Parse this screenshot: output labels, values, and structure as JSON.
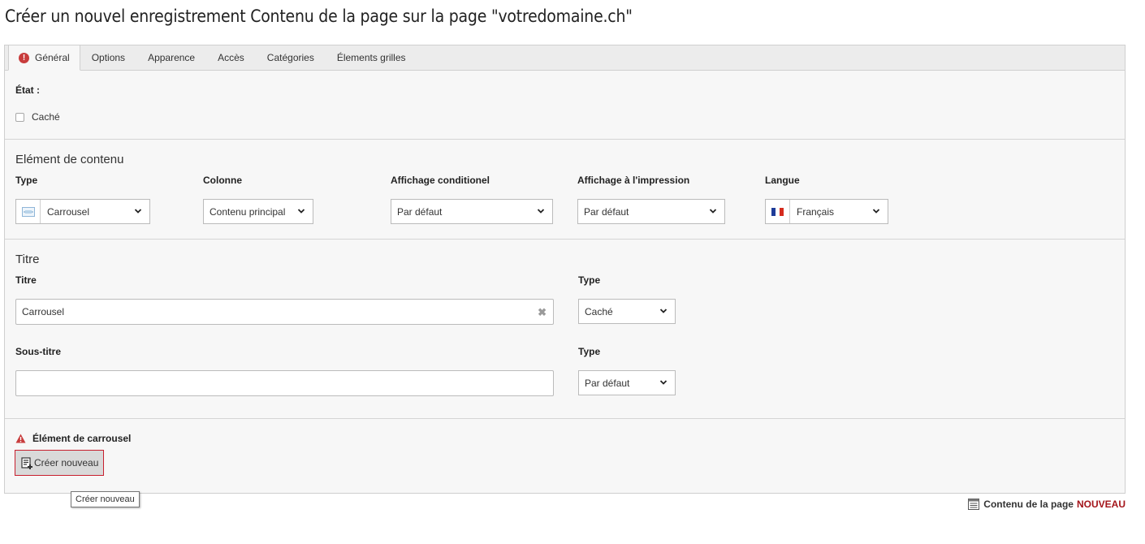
{
  "page_title": "Créer un nouvel enregistrement Contenu de la page sur la page \"votredomaine.ch\"",
  "tabs": [
    {
      "label": "Général",
      "active": true,
      "has_error": true
    },
    {
      "label": "Options"
    },
    {
      "label": "Apparence"
    },
    {
      "label": "Accès"
    },
    {
      "label": "Catégories"
    },
    {
      "label": "Élements grilles"
    }
  ],
  "etat": {
    "label": "État :",
    "hidden_checkbox_label": "Caché",
    "hidden_checked": false
  },
  "content_element": {
    "title": "Elément de contenu",
    "type": {
      "label": "Type",
      "value": "Carrousel",
      "icon": "carousel-icon"
    },
    "colonne": {
      "label": "Colonne",
      "value": "Contenu principal"
    },
    "affichage_conditionnel": {
      "label": "Affichage conditionel",
      "value": "Par défaut"
    },
    "affichage_impression": {
      "label": "Affichage à l'impression",
      "value": "Par défaut"
    },
    "langue": {
      "label": "Langue",
      "value": "Français",
      "icon": "france-flag-icon"
    }
  },
  "titre_section": {
    "title": "Titre",
    "titre": {
      "label": "Titre",
      "value": "Carrousel",
      "clear_symbol": "✖"
    },
    "titre_type": {
      "label": "Type",
      "value": "Caché"
    },
    "sous_titre": {
      "label": "Sous-titre",
      "value": ""
    },
    "sous_titre_type": {
      "label": "Type",
      "value": "Par défaut"
    }
  },
  "carrousel": {
    "label": "Élément de carrousel",
    "create_button": "Créer nouveau",
    "tooltip": "Créer nouveau"
  },
  "footer": {
    "record_label": "Contenu de la page",
    "status": "NOUVEAU"
  },
  "colors": {
    "error_red": "#c83c3c",
    "accent_red": "#a4141a",
    "panel_bg": "#f7f7f7",
    "tab_bar_bg": "#ececec"
  }
}
